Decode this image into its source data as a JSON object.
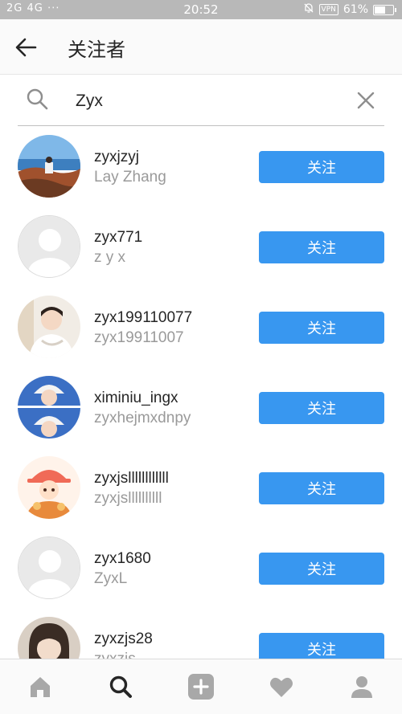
{
  "status_bar": {
    "left": "2G 4G ⋅⋅⋅",
    "time": "20:52",
    "vpn": "VPN",
    "battery": "61%"
  },
  "header": {
    "title": "关注者"
  },
  "search": {
    "query": "Zyx"
  },
  "users": [
    {
      "username": "zyxjzyj",
      "fullname": "Lay Zhang",
      "button": "关注",
      "avatar": "photo-beach"
    },
    {
      "username": "zyx771",
      "fullname": "z y x",
      "button": "关注",
      "avatar": "default"
    },
    {
      "username": "zyx199110077",
      "fullname": "zyx19911007",
      "button": "关注",
      "avatar": "photo-man-light"
    },
    {
      "username": "ximiniu_ingx",
      "fullname": "zyxhejmxdnpy",
      "button": "关注",
      "avatar": "photo-blue-cap"
    },
    {
      "username": "zyxjsllllllllllll",
      "fullname": "zyxjsllllllllll",
      "button": "关注",
      "avatar": "photo-cartoon-hat"
    },
    {
      "username": "zyx1680",
      "fullname": "ZyxL",
      "button": "关注",
      "avatar": "default"
    },
    {
      "username": "zyxzjs28",
      "fullname": "zyxzjs",
      "button": "关注",
      "avatar": "photo-girl"
    }
  ],
  "nav": [
    "home-icon",
    "search-icon",
    "add-icon",
    "heart-icon",
    "profile-icon"
  ],
  "colors": {
    "accent": "#3897f0",
    "muted": "#9a9a9a"
  }
}
